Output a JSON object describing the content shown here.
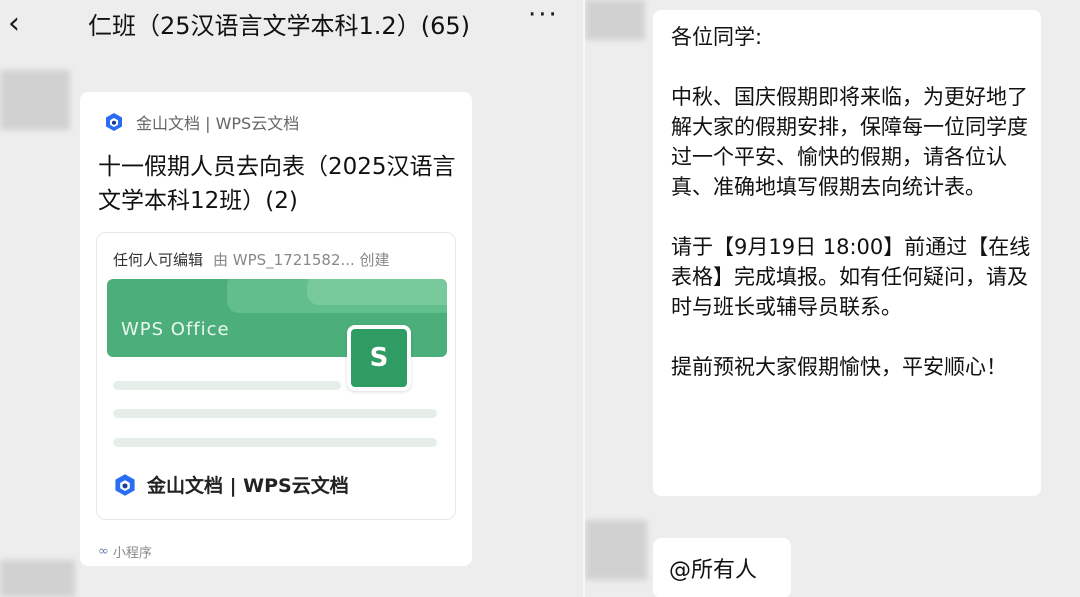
{
  "header": {
    "back_icon": "‹",
    "title": "仁班（25汉语言文学本科1.2）(65)",
    "more_icon": "···"
  },
  "card": {
    "source_label": "金山文档 | WPS云文档",
    "title": "十一假期人员去向表（2025汉语言文学本科12班）(2)",
    "permission": "任何人可编辑",
    "created_by": "由  WPS_1721582... 创建",
    "banner_text": "WPS Office",
    "s_icon_letter": "S",
    "brand_label": "金山文档 | WPS云文档",
    "mini_program_label": "小程序",
    "colors": {
      "banner": "#4caf7b",
      "icon": "#2f9d63",
      "logo_blue": "#2a6df5"
    }
  },
  "message": {
    "p1": "各位同学:",
    "p2": "中秋、国庆假期即将来临，为更好地了解大家的假期安排，保障每一位同学度过一个平安、愉快的假期，请各位认真、准确地填写假期去向统计表。",
    "p3": "请于【9月19日 18:00】前通过【在线表格】完成填报。如有任何疑问，请及时与班长或辅导员联系。",
    "p4": "提前预祝大家假期愉快，平安顺心！"
  },
  "mention": {
    "text": "@所有人"
  }
}
